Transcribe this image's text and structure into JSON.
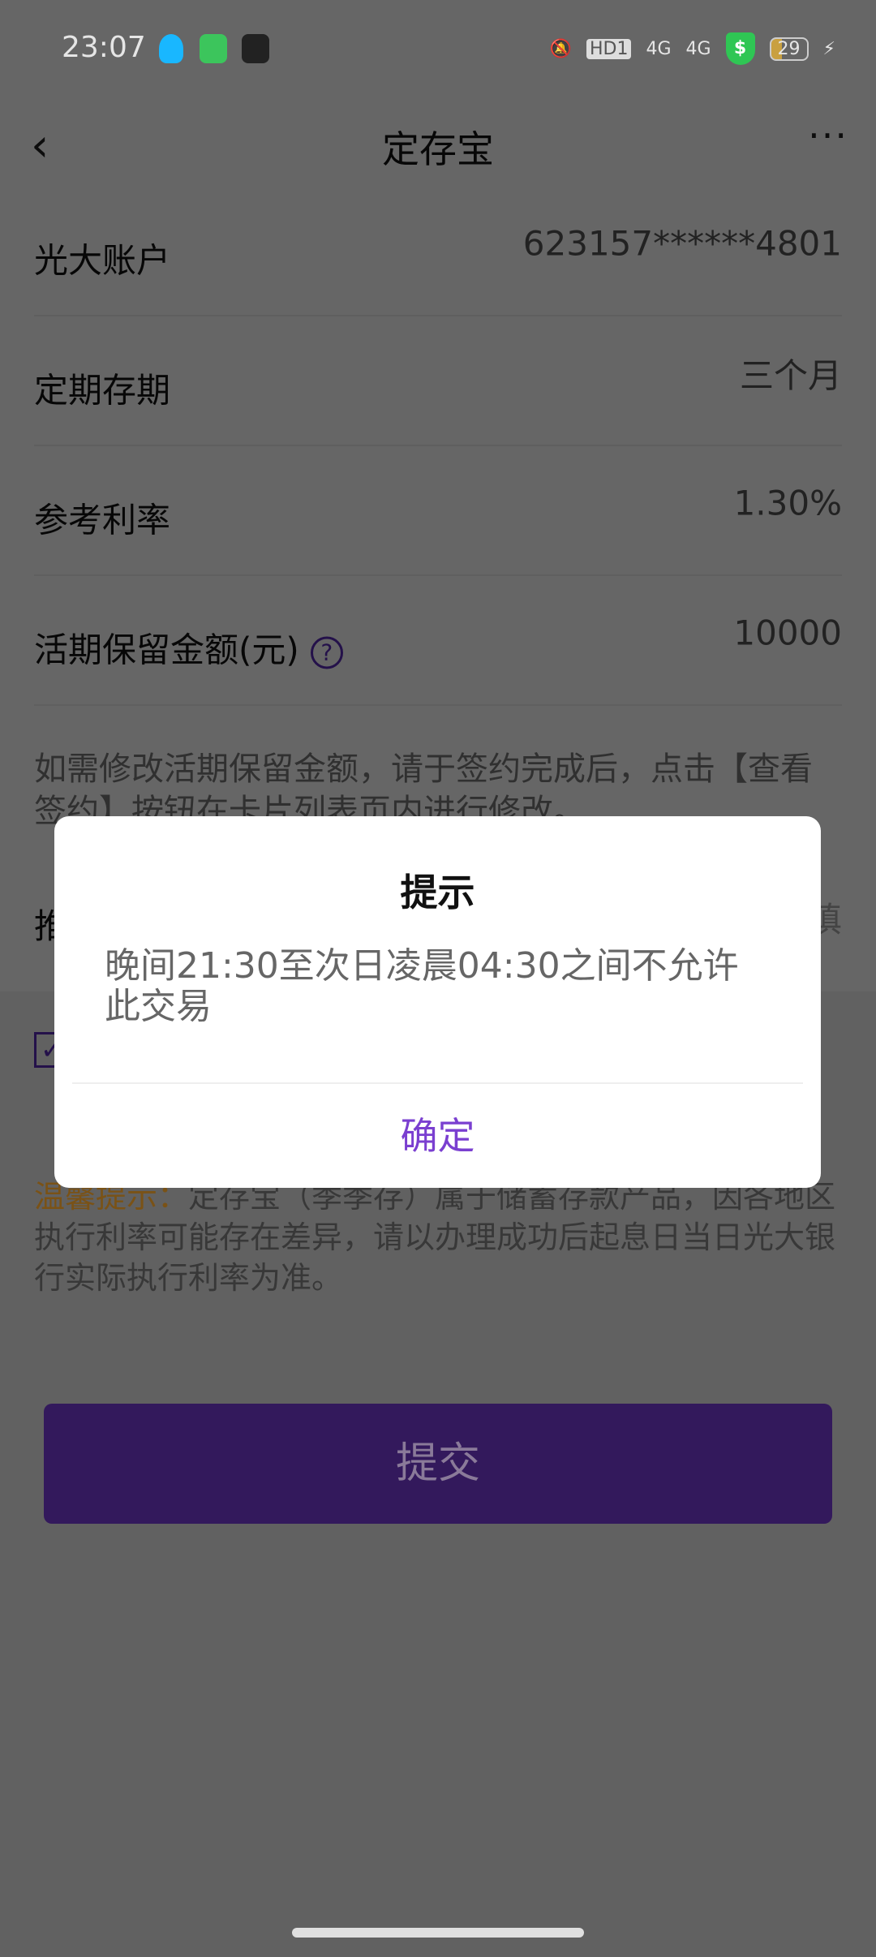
{
  "status_bar": {
    "time": "23:07",
    "battery": "29",
    "network": [
      "HD1",
      "4G",
      "4G"
    ]
  },
  "header": {
    "title": "定存宝",
    "back_icon": "chevron-left-icon",
    "more_icon": "more-dots-icon"
  },
  "form": {
    "rows": [
      {
        "label": "光大账户",
        "value": "623157******4801"
      },
      {
        "label": "定期存期",
        "value": "三个月"
      },
      {
        "label": "参考利率",
        "value": "1.30%"
      },
      {
        "label": "活期保留金额(元)",
        "value": "10000"
      }
    ],
    "note": "如需修改活期保留金额，请于签约完成后，点击【查看签约】按钮在卡片列表页内进行修改。",
    "partial_row": {
      "label": "推",
      "value": "填"
    }
  },
  "tip": {
    "label": "温馨提示：",
    "text": "定存宝（季季存）属于储蓄存款产品，因各地区执行利率可能存在差异，请以办理成功后起息日当日光大银行实际执行利率为准。"
  },
  "submit_label": "提交",
  "dialog": {
    "title": "提示",
    "message": "晚间21:30至次日凌晨04:30之间不允许此交易",
    "ok_label": "确定"
  },
  "colors": {
    "accent": "#7a3fd0",
    "tip": "#d08a1c"
  }
}
